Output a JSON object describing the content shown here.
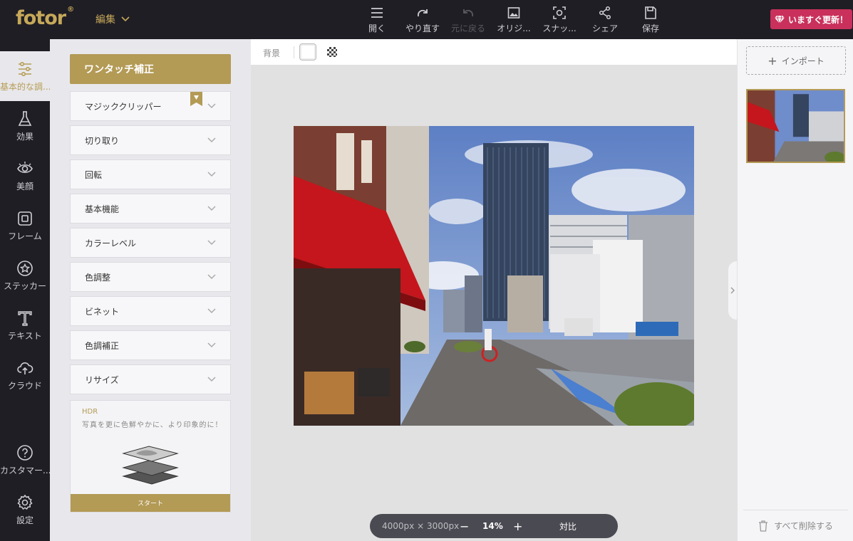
{
  "app": {
    "logo": "fotor",
    "logo_mark": "®"
  },
  "topbar": {
    "edit_menu": "編集",
    "tools": [
      {
        "label": "開く",
        "icon": "menu-icon",
        "disabled": false
      },
      {
        "label": "やり直す",
        "icon": "redo-icon",
        "disabled": false
      },
      {
        "label": "元に戻る",
        "icon": "undo-icon",
        "disabled": true
      },
      {
        "label": "オリジ...",
        "icon": "image-icon",
        "disabled": false
      },
      {
        "label": "スナッ...",
        "icon": "snapshot-icon",
        "disabled": false
      },
      {
        "label": "シェア",
        "icon": "share-icon",
        "disabled": false
      },
      {
        "label": "保存",
        "icon": "save-icon",
        "disabled": false
      }
    ],
    "upgrade": "いますぐ更新！"
  },
  "leftnav": [
    {
      "label": "基本的な調...",
      "icon": "sliders-icon"
    },
    {
      "label": "効果",
      "icon": "flask-icon"
    },
    {
      "label": "美顔",
      "icon": "eye-icon"
    },
    {
      "label": "フレーム",
      "icon": "frame-icon"
    },
    {
      "label": "ステッカー",
      "icon": "sticker-icon"
    },
    {
      "label": "テキスト",
      "icon": "text-icon"
    },
    {
      "label": "クラウド",
      "icon": "cloud-icon"
    },
    {
      "label": "カスタマー...",
      "icon": "help-icon"
    },
    {
      "label": "設定",
      "icon": "gear-icon"
    }
  ],
  "panel": {
    "onetouch": "ワンタッチ補正",
    "items": [
      "マジッククリッパー",
      "切り取り",
      "回転",
      "基本機能",
      "カラーレベル",
      "色調整",
      "ビネット",
      "色調補正",
      "リサイズ"
    ],
    "hdr": {
      "title": "HDR",
      "desc": "写真を更に色鮮やかに、より印象的に！",
      "start": "スタート"
    }
  },
  "canvas": {
    "bg_label": "背景",
    "size": "4000px × 3000px",
    "zoom": "14%",
    "compare": "対比"
  },
  "rightpanel": {
    "import": "インポート",
    "delete_all": "すべて削除する"
  },
  "colors": {
    "accent": "#b39a55",
    "dark": "#1f1e24",
    "upgrade": "#c9305b"
  }
}
